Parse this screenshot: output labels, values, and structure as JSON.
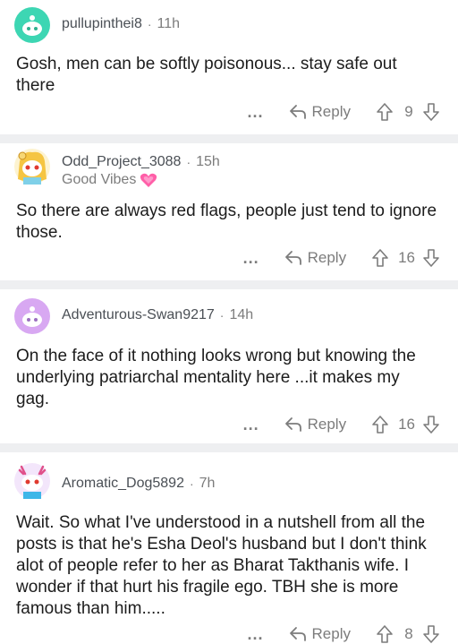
{
  "comments": [
    {
      "username": "pullupinthei8",
      "time": "11h",
      "flair": "",
      "body": "Gosh, men can be softly poisonous... stay safe out there",
      "more": "...",
      "reply_label": "Reply",
      "votes": "9",
      "avatar_color": "#3dd6b3"
    },
    {
      "username": "Odd_Project_3088",
      "time": "15h",
      "flair": "Good Vibes",
      "body": "So there are always red flags, people just tend to ignore those.",
      "more": "...",
      "reply_label": "Reply",
      "votes": "16",
      "avatar_color": "#f5c542"
    },
    {
      "username": "Adventurous-Swan9217",
      "time": "14h",
      "flair": "",
      "body": "On the face of it nothing looks wrong but knowing the underlying patriarchal mentality here ...it makes my gag.",
      "more": "...",
      "reply_label": "Reply",
      "votes": "16",
      "avatar_color": "#d8a8f2"
    },
    {
      "username": "Aromatic_Dog5892",
      "time": "7h",
      "flair": "",
      "body": "Wait. So what I've understood in a nutshell from all the posts is that he's Esha Deol's husband but I don't think alot of people refer to her as Bharat Takthanis wife. I wonder if that hurt his fragile ego. TBH she is more famous than him.....",
      "more": "...",
      "reply_label": "Reply",
      "votes": "8",
      "avatar_color": "#b57ee0"
    }
  ],
  "separator": "·"
}
